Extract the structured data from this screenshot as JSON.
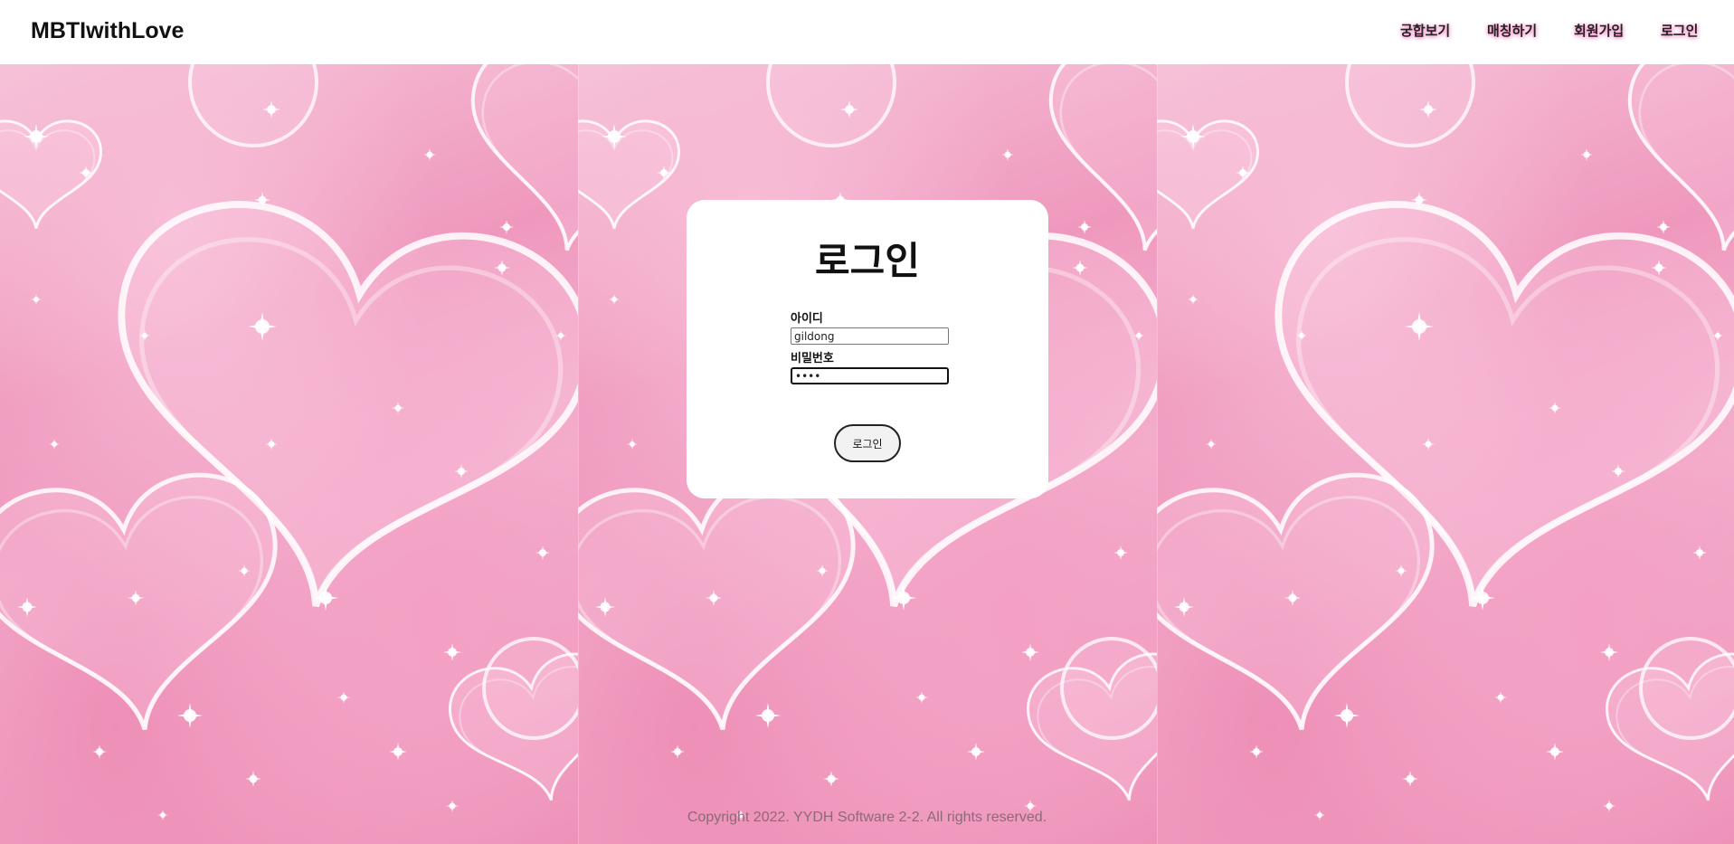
{
  "header": {
    "brand": "MBTIwithLove",
    "nav": [
      {
        "label": "궁합보기"
      },
      {
        "label": "매칭하기"
      },
      {
        "label": "회원가입"
      },
      {
        "label": "로그인"
      }
    ]
  },
  "background": {
    "colors": {
      "light_pink": "#f6c4da",
      "mid_pink": "#ef98bd",
      "deep_pink": "#ec8db5"
    }
  },
  "login_card": {
    "title": "로그인",
    "id_label": "아이디",
    "id_value": "gildong",
    "password_label": "비밀번호",
    "password_masked": "••••",
    "submit_label": "로그인"
  },
  "footer": {
    "copyright": "Copyright 2022. YYDH Software 2-2. All rights reserved."
  }
}
